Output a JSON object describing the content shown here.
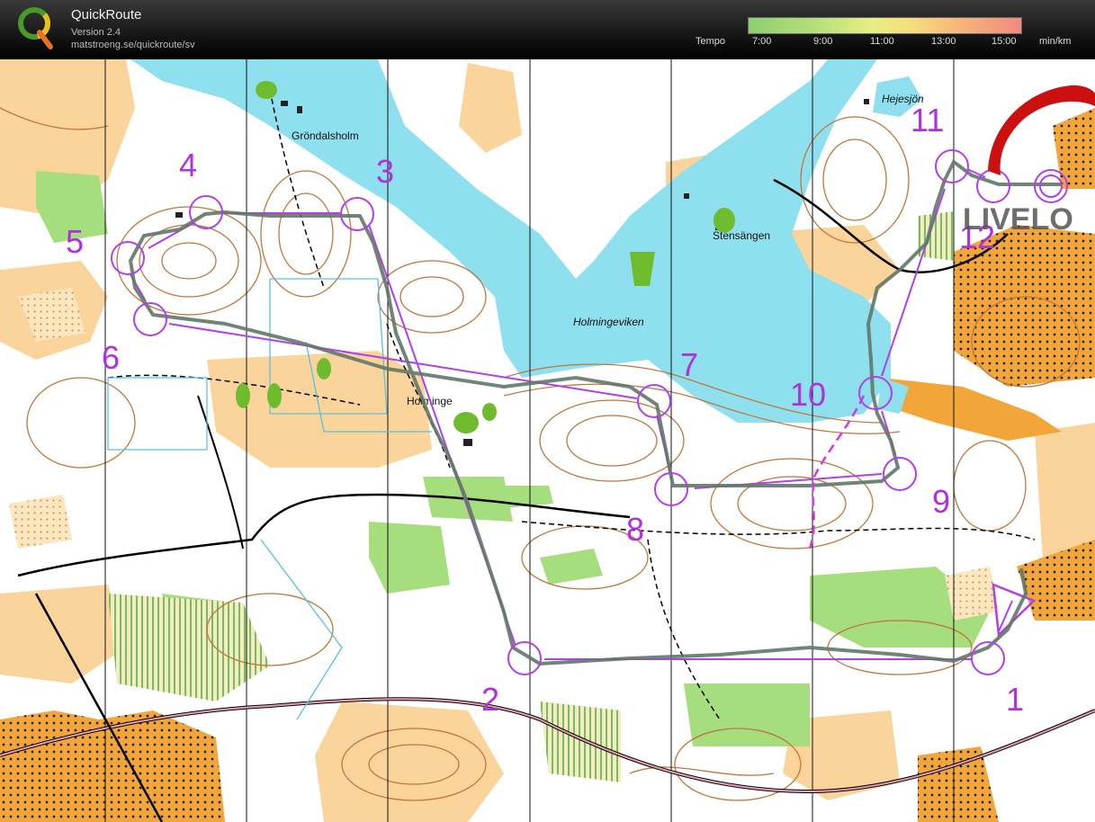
{
  "app": {
    "name": "QuickRoute",
    "version": "Version 2.4",
    "url": "matstroeng.se/quickroute/sv"
  },
  "legend": {
    "label": "Tempo",
    "ticks": [
      "7:00",
      "9:00",
      "11:00",
      "13:00",
      "15:00"
    ],
    "unit": "min/km"
  },
  "map": {
    "places": [
      "Gröndalsholm",
      "Stensängen",
      "Holmingeviken",
      "Holminge",
      "Hejesjön"
    ],
    "watermark": "LIVELO",
    "controls": [
      "1",
      "2",
      "3",
      "4",
      "5",
      "6",
      "7",
      "8",
      "9",
      "10",
      "11",
      "12"
    ],
    "colors": {
      "water": "#8ee0ee",
      "course": "#b040e8",
      "route": "#607868",
      "contour": "#c0763c",
      "open": "#fad49a",
      "forest_green": "#a6dd7d"
    }
  }
}
